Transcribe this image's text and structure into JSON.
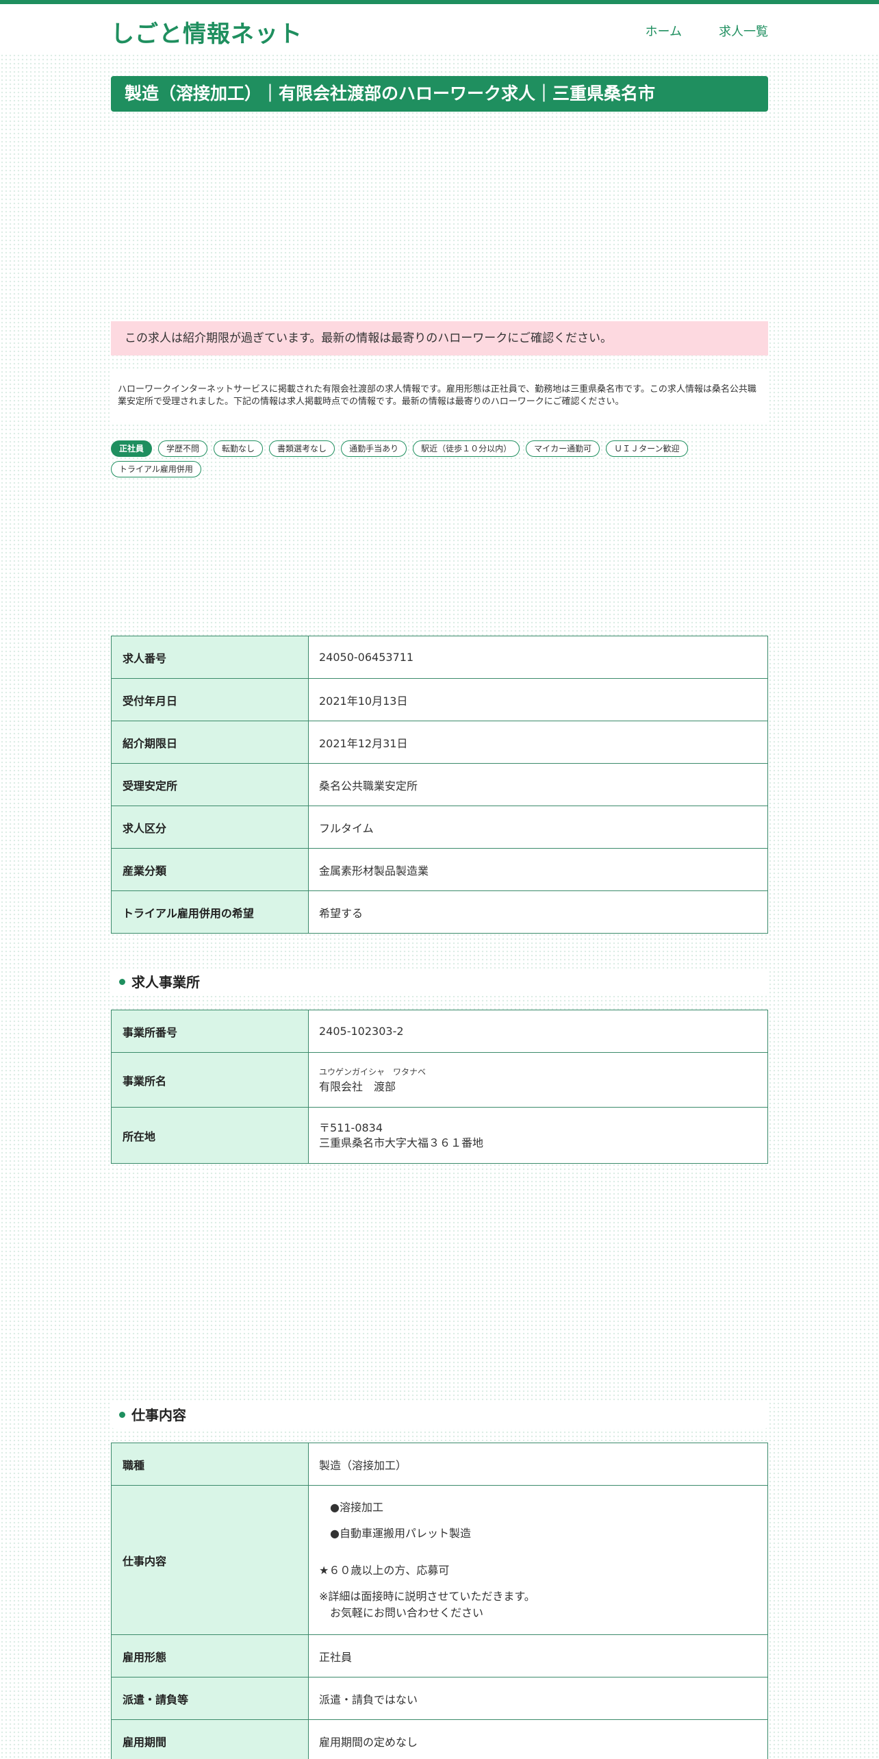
{
  "header": {
    "brand": "しごと情報ネット",
    "nav": [
      "ホーム",
      "求人一覧"
    ]
  },
  "page_title": "製造（溶接加工）｜有限会社渡部のハローワーク求人｜三重県桑名市",
  "notice": "この求人は紹介期限が過ぎています。最新の情報は最寄りのハローワークにご確認ください。",
  "description": "ハローワークインターネットサービスに掲載された有限会社渡部の求人情報です。雇用形態は正社員で、勤務地は三重県桑名市です。この求人情報は桑名公共職業安定所で受理されました。下記の情報は求人掲載時点での情報です。最新の情報は最寄りのハローワークにご確認ください。",
  "tags": [
    "正社員",
    "学歴不問",
    "転勤なし",
    "書類選考なし",
    "通勤手当あり",
    "駅近（徒歩１０分以内）",
    "マイカー通勤可",
    "ＵＩＪターン歓迎",
    "トライアル雇用併用"
  ],
  "summary_table": [
    {
      "label": "求人番号",
      "value": "24050-06453711"
    },
    {
      "label": "受付年月日",
      "value": "2021年10月13日"
    },
    {
      "label": "紹介期限日",
      "value": "2021年12月31日"
    },
    {
      "label": "受理安定所",
      "value": "桑名公共職業安定所"
    },
    {
      "label": "求人区分",
      "value": "フルタイム"
    },
    {
      "label": "産業分類",
      "value": "金属素形材製品製造業"
    },
    {
      "label": "トライアル雇用併用の希望",
      "value": "希望する"
    }
  ],
  "office_section": {
    "heading": "求人事業所",
    "rows": {
      "number_label": "事業所番号",
      "number_value": "2405-102303-2",
      "name_label": "事業所名",
      "name_kana": "ユウゲンガイシャ　ワタナベ",
      "name_value": "有限会社　渡部",
      "address_label": "所在地",
      "postal": "〒511-0834",
      "address": "三重県桑名市大字大福３６１番地"
    }
  },
  "job_section": {
    "heading": "仕事内容",
    "occupation_label": "職種",
    "occupation_value": "製造（溶接加工）",
    "content_label": "仕事内容",
    "content_lines": [
      "　●溶接加工",
      "　●自動車運搬用パレット製造",
      "★６０歳以上の方、応募可",
      "※詳細は面接時に説明させていただきます。",
      "　お気軽にお問い合わせください"
    ],
    "employment_label": "雇用形態",
    "employment_value": "正社員",
    "dispatch_label": "派遣・請負等",
    "dispatch_value": "派遣・請負ではない",
    "period_label": "雇用期間",
    "period_value": "雇用期間の定めなし"
  },
  "colors": {
    "accent": "#1f8f5f",
    "label_bg": "#d9f5e7",
    "notice_bg": "#fdd9e0"
  }
}
